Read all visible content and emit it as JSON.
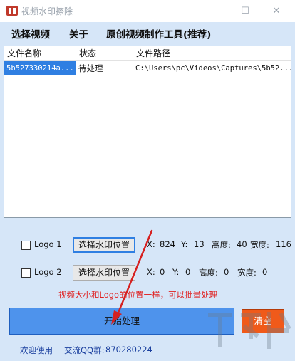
{
  "window": {
    "title": "视频水印擦除",
    "controls": {
      "minimize": "—",
      "maximize": "☐",
      "close": "✕"
    }
  },
  "menu": [
    "选择视频",
    "关于",
    "原创视频制作工具(推荐)"
  ],
  "table": {
    "columns": [
      "文件名称",
      "状态",
      "文件路径"
    ],
    "rows": [
      {
        "name": "5b527330214a...",
        "status": "待处理",
        "path": "C:\\Users\\pc\\Videos\\Captures\\5b52..."
      }
    ]
  },
  "logos": [
    {
      "label": "Logo 1",
      "button": "选择水印位置",
      "x_label": "X:",
      "x": "824",
      "y_label": "Y:",
      "y": "13",
      "h_label": "高度:",
      "h": "40",
      "w_label": "宽度:",
      "w": "116"
    },
    {
      "label": "Logo 2",
      "button": "选择水印位置",
      "x_label": "X:",
      "x": "0",
      "y_label": "Y:",
      "y": "0",
      "h_label": "高度:",
      "h": "0",
      "w_label": "宽度:",
      "w": "0"
    }
  ],
  "hint": "视频大小和Logo的位置一样，可以批量处理",
  "buttons": {
    "start": "开始处理",
    "clear": "清空"
  },
  "footer": {
    "welcome": "欢迎使用",
    "qq_label": "交流QQ群:",
    "qq_number": "870280224"
  },
  "colors": {
    "accent": "#4e93ec",
    "danger": "#f05a1a",
    "hint": "#e02020",
    "selection": "#2f7fe2"
  }
}
